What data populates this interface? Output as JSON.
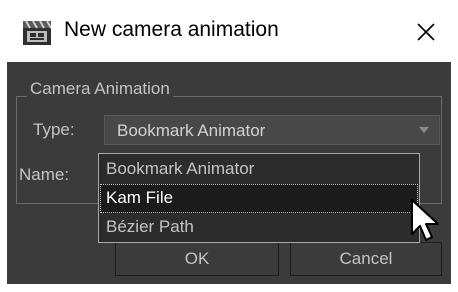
{
  "window": {
    "title": "New camera animation",
    "icon": "film-clapper-icon",
    "close_icon": "close-icon"
  },
  "group": {
    "title": "Camera Animation"
  },
  "type_field": {
    "label": "Type:",
    "value": "Bookmark Animator",
    "arrow_icon": "chevron-down-icon"
  },
  "name_field": {
    "label": "Name:"
  },
  "dropdown": {
    "options": [
      "Bookmark Animator",
      "Kam File",
      "Bézier Path"
    ],
    "highlighted": "Kam File"
  },
  "buttons": {
    "ok": "OK",
    "cancel": "Cancel"
  },
  "colors": {
    "panel": "#3b3b3b",
    "text": "#c4c4c4",
    "list_bg": "#2c2c2c"
  }
}
